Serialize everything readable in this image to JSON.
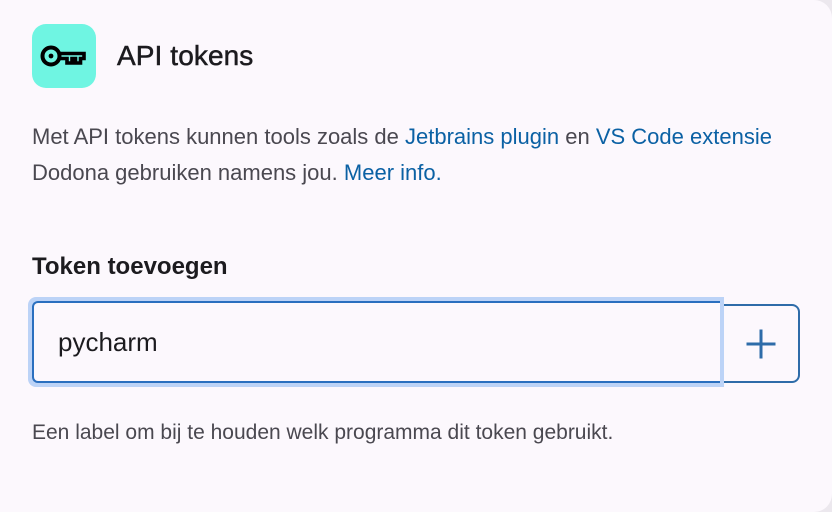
{
  "colors": {
    "icon_tile_bg": "#6ff5e2",
    "icon_stroke": "#000000",
    "link": "#0b61a4",
    "input_focus_ring": "#bcd3f7",
    "input_border": "#2a6fbf",
    "button_accent": "#2e6ca9"
  },
  "header": {
    "icon": "key-icon",
    "title": "API tokens"
  },
  "description": {
    "text_1": "Met API tokens kunnen tools zoals de ",
    "link_jetbrains": "Jetbrains plugin",
    "text_2": " en ",
    "link_vscode": "VS Code extensie",
    "text_3": " Dodona gebruiken namens jou. ",
    "link_more_info": "Meer info."
  },
  "form": {
    "label": "Token toevoegen",
    "input_value": "pycharm",
    "add_button_icon": "plus-icon",
    "helper_text": "Een label om bij te houden welk programma dit token gebruikt."
  }
}
